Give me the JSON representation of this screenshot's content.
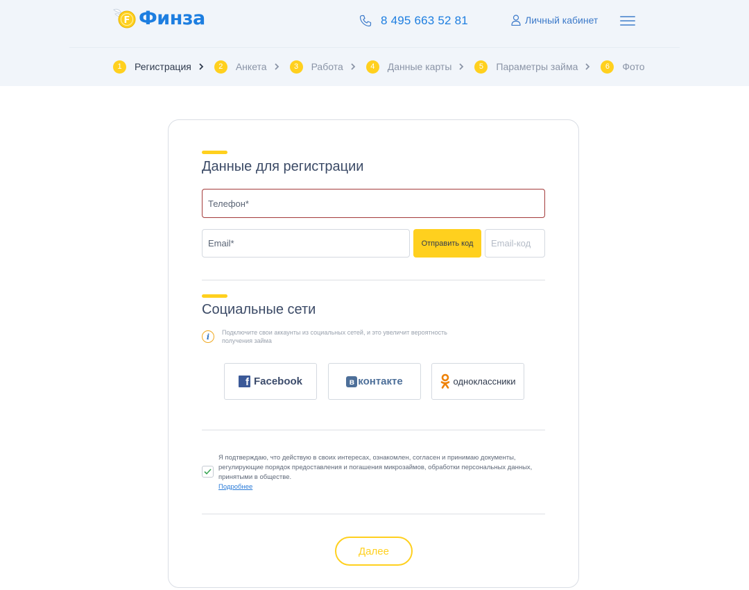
{
  "header": {
    "brand": "Финза",
    "logo_icon": "winged-coin-logo",
    "coin_letter": "F",
    "phone": "8 495 663 52 81",
    "phone_icon": "phone-icon",
    "cabinet_label": "Личный кабинет",
    "cabinet_icon": "user-icon",
    "menu_icon": "hamburger-menu-icon"
  },
  "steps": [
    {
      "num": "1",
      "label": "Регистрация",
      "active": true
    },
    {
      "num": "2",
      "label": "Анкета",
      "active": false
    },
    {
      "num": "3",
      "label": "Работа",
      "active": false
    },
    {
      "num": "4",
      "label": "Данные карты",
      "active": false
    },
    {
      "num": "5",
      "label": "Параметры займа",
      "active": false
    },
    {
      "num": "6",
      "label": "Фото",
      "active": false
    }
  ],
  "registration": {
    "title": "Данные для регистрации",
    "phone_placeholder": "Телефон*",
    "email_placeholder": "Email*",
    "send_code_label": "Отправить код",
    "email_code_placeholder": "Email-код"
  },
  "social": {
    "title": "Социальные сети",
    "info_text": "Подключите свои аккаунты из социальных сетей, и это увеличит вероятность получения займа",
    "facebook_label": "Facebook",
    "vk_badge": "в",
    "vk_label": "контакте",
    "ok_label": "одноклассники"
  },
  "consent": {
    "checked": true,
    "text": "Я подтверждаю, что действую в своих интересах, ознакомлен, согласен и принимаю документы, регулирующие порядок предоставления и погашения микрозаймов, обработки персональных данных, принятыми в обществе.",
    "link_label": "Подробнее"
  },
  "next_label": "Далее",
  "colors": {
    "accent": "#ffd01e",
    "brand_blue": "#1d7ee0",
    "error_border": "#a33a3a",
    "check_green": "#3aa655"
  }
}
